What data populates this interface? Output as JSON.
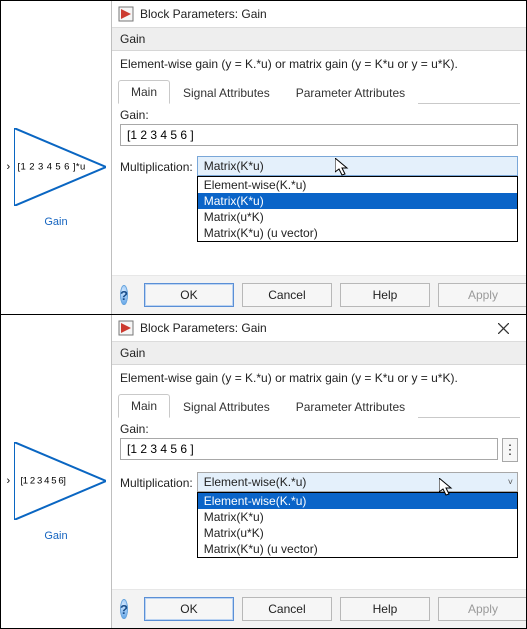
{
  "window_title": "Block Parameters: Gain",
  "section_title": "Gain",
  "description": "Element-wise gain (y = K.*u) or matrix gain (y = K*u or y = u*K).",
  "tabs": {
    "main": "Main",
    "signal": "Signal Attributes",
    "param": "Parameter Attributes"
  },
  "gain_label": "Gain:",
  "mult_label": "Multiplication:",
  "buttons": {
    "ok": "OK",
    "cancel": "Cancel",
    "help": "Help",
    "apply": "Apply"
  },
  "block_name": "Gain",
  "panel_top": {
    "block_text": "[1 2 3 4 5 6 ]*u",
    "gain_value": "[1 2 3 4 5 6 ]",
    "combo_value": "Matrix(K*u)",
    "dropdown": {
      "items": [
        "Element-wise(K.*u)",
        "Matrix(K*u)",
        "Matrix(u*K)",
        "Matrix(K*u) (u vector)"
      ],
      "selected_index": 1
    }
  },
  "panel_bottom": {
    "block_text": "[1 2 3 4 5 6]",
    "gain_value": "[1 2 3 4 5 6 ]",
    "combo_value": "Element-wise(K.*u)",
    "dropdown": {
      "items": [
        "Element-wise(K.*u)",
        "Matrix(K*u)",
        "Matrix(u*K)",
        "Matrix(K*u) (u vector)"
      ],
      "selected_index": 0
    }
  }
}
